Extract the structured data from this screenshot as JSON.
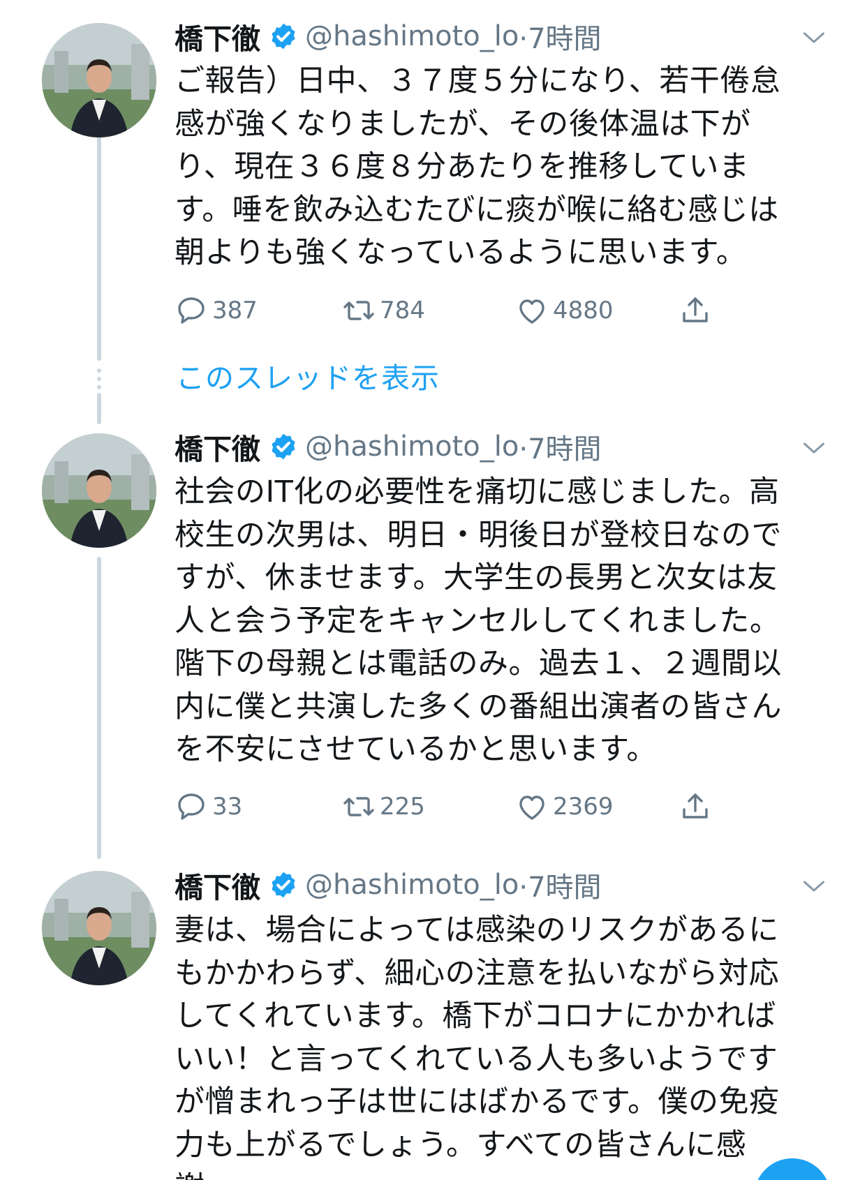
{
  "colors": {
    "accent": "#1da1f2",
    "text": "#14171a",
    "muted": "#657786",
    "thread_line": "#ccd6dd"
  },
  "show_thread_label": "このスレッドを表示",
  "tweets": [
    {
      "name": "橋下徹",
      "handle": "@hashimoto_lo",
      "time": "·7時間",
      "verified_icon": "verified-badge-icon",
      "lines": [
        "ご報告）日中、３７度５分になり、若干倦怠",
        "感が強くなりましたが、その後体温は下が",
        "り、現在３６度８分あたりを推移していま",
        "す。唾を飲み込むたびに痰が喉に絡む感じは",
        "朝よりも強くなっているように思います。"
      ],
      "replies": "387",
      "retweets": "784",
      "likes": "4880"
    },
    {
      "name": "橋下徹",
      "handle": "@hashimoto_lo",
      "time": "·7時間",
      "verified_icon": "verified-badge-icon",
      "lines": [
        "社会のIT化の必要性を痛切に感じました。高",
        "校生の次男は、明日・明後日が登校日なので",
        "すが、休ませます。大学生の長男と次女は友",
        "人と会う予定をキャンセルしてくれました。",
        "階下の母親とは電話のみ。過去１、２週間以",
        "内に僕と共演した多くの番組出演者の皆さん",
        "を不安にさせているかと思います。"
      ],
      "replies": "33",
      "retweets": "225",
      "likes": "2369"
    },
    {
      "name": "橋下徹",
      "handle": "@hashimoto_lo",
      "time": "·7時間",
      "verified_icon": "verified-badge-icon",
      "lines": [
        "妻は、場合によっては感染のリスクがあるに",
        "もかかわらず、細心の注意を払いながら対応",
        "してくれています。橋下がコロナにかかれば",
        "いい！と言ってくれている人も多いようです",
        "が憎まれっ子は世にはばかるです。僕の免疫",
        "力も上がるでしょう。すべての皆さんに感",
        "謝"
      ]
    }
  ]
}
